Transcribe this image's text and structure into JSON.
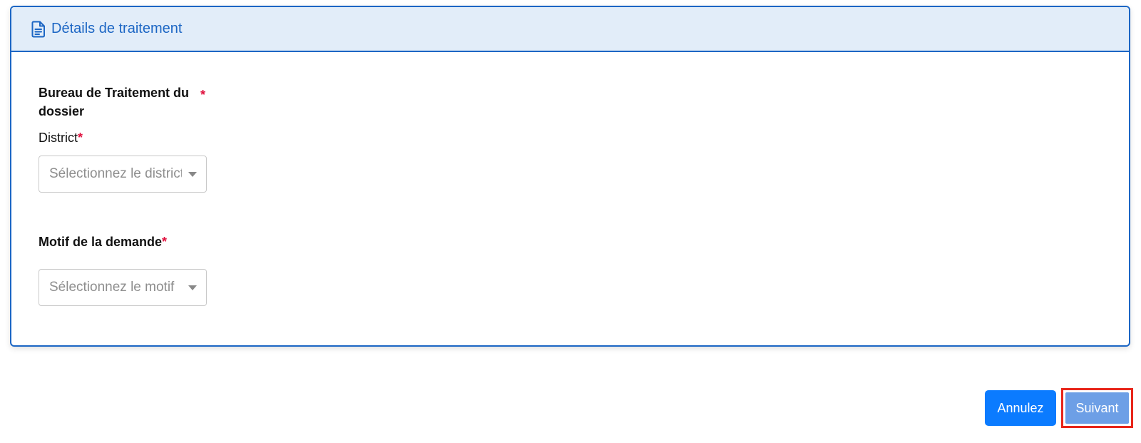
{
  "card": {
    "title": "Détails de traitement",
    "icon": "document-icon"
  },
  "bureau": {
    "label": "Bureau de Traitement du dossier",
    "required_marker": "*"
  },
  "district": {
    "label": "District",
    "required_marker": "*",
    "placeholder": "Sélectionnez le district"
  },
  "motif": {
    "label": "Motif de la demande",
    "required_marker": "*",
    "placeholder": "Sélectionnez le motif"
  },
  "actions": {
    "cancel_label": "Annulez",
    "next_label": "Suivant"
  },
  "colors": {
    "accent": "#1c66c4",
    "header_bg": "#e2edf9",
    "required": "#e0123f",
    "cancel_button": "#0b7bff",
    "next_button": "#6d9fe6",
    "highlight_frame": "#e8261a"
  }
}
